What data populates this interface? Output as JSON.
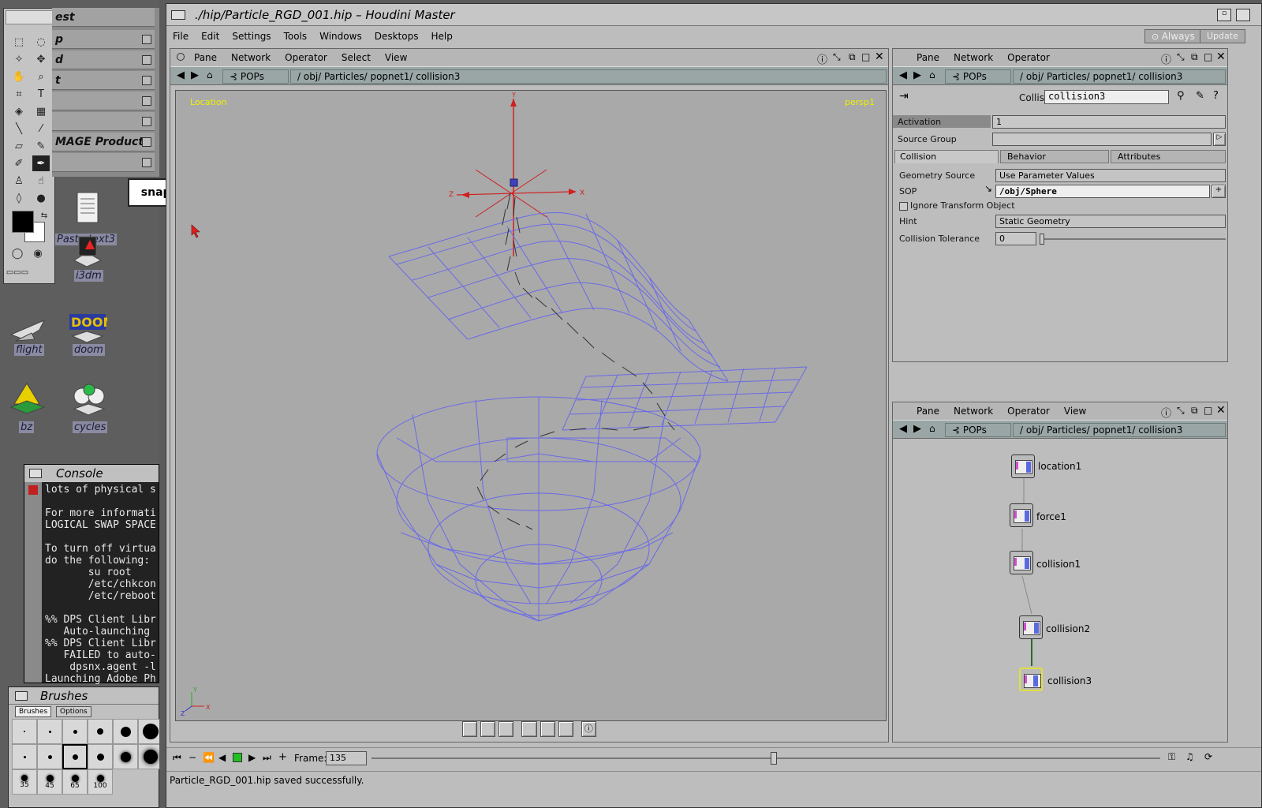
{
  "desktop": {
    "menu_items": [
      "est",
      "p",
      "d",
      "t",
      "",
      "",
      "MAGE Products",
      ""
    ],
    "snapshot_label": "snapshot",
    "icons": [
      {
        "name": "Paste text3",
        "icon": "document-icon"
      },
      {
        "name": "i3dm",
        "icon": "i3dm-icon"
      },
      {
        "name": "flight",
        "icon": "jet-icon"
      },
      {
        "name": "doom",
        "icon": "doom-icon"
      },
      {
        "name": "bz",
        "icon": "tank-icon"
      },
      {
        "name": "cycles",
        "icon": "cycles-icon"
      }
    ],
    "console": {
      "title": "Console",
      "lines": "lots of physical s\n\nFor more informati\nLOGICAL SWAP SPACE\n\nTo turn off virtua\ndo the following:\n       su root\n       /etc/chkcon\n       /etc/reboot\n\n%% DPS Client Libr\n   Auto-launching\n%% DPS Client Libr\n   FAILED to auto-\n    dpsnx.agent -l\nLaunching Adobe Ph"
    },
    "brushes": {
      "title": "Brushes",
      "tabs": [
        "Brushes",
        "Options"
      ],
      "sizes": [
        "35",
        "45",
        "65",
        "100"
      ]
    }
  },
  "window": {
    "title": "./hip/Particle_RGD_001.hip – Houdini Master",
    "menu": [
      "File",
      "Edit",
      "Settings",
      "Tools",
      "Windows",
      "Desktops",
      "Help"
    ],
    "always_label": "Always",
    "update_label": "Update"
  },
  "viewer": {
    "menu": [
      "Pane",
      "Network",
      "Operator",
      "Select",
      "View"
    ],
    "context": "POPs",
    "path": "/ obj/ Particles/ popnet1/ collision3",
    "label_left": "Location",
    "label_right": "persp1",
    "axis_x": "X",
    "axis_y": "Y",
    "axis_z": "Z"
  },
  "params": {
    "menu": [
      "Pane",
      "Network",
      "Operator"
    ],
    "context": "POPs",
    "path": "/ obj/ Particles/ popnet1/ collision3",
    "op_type": "Collision",
    "op_name": "collision3",
    "activation_label": "Activation",
    "activation_value": "1",
    "source_group_label": "Source Group",
    "source_group_value": "",
    "tabs": [
      "Collision",
      "Behavior",
      "Attributes"
    ],
    "geometry_source_label": "Geometry Source",
    "geometry_source_value": "Use Parameter Values",
    "sop_label": "SOP",
    "sop_value": "/obj/Sphere",
    "ignore_label": "Ignore Transform Object",
    "hint_label": "Hint",
    "hint_value": "Static Geometry",
    "tolerance_label": "Collision Tolerance",
    "tolerance_value": "0"
  },
  "network": {
    "menu": [
      "Pane",
      "Network",
      "Operator",
      "View"
    ],
    "context": "POPs",
    "path": "/ obj/ Particles/ popnet1/ collision3",
    "nodes": [
      "location1",
      "force1",
      "collision1",
      "collision2",
      "collision3"
    ]
  },
  "timeline": {
    "frame_label": "Frame:",
    "frame_value": "135",
    "progress": 0.51
  },
  "status": {
    "message": "Particle_RGD_001.hip saved successfully."
  }
}
